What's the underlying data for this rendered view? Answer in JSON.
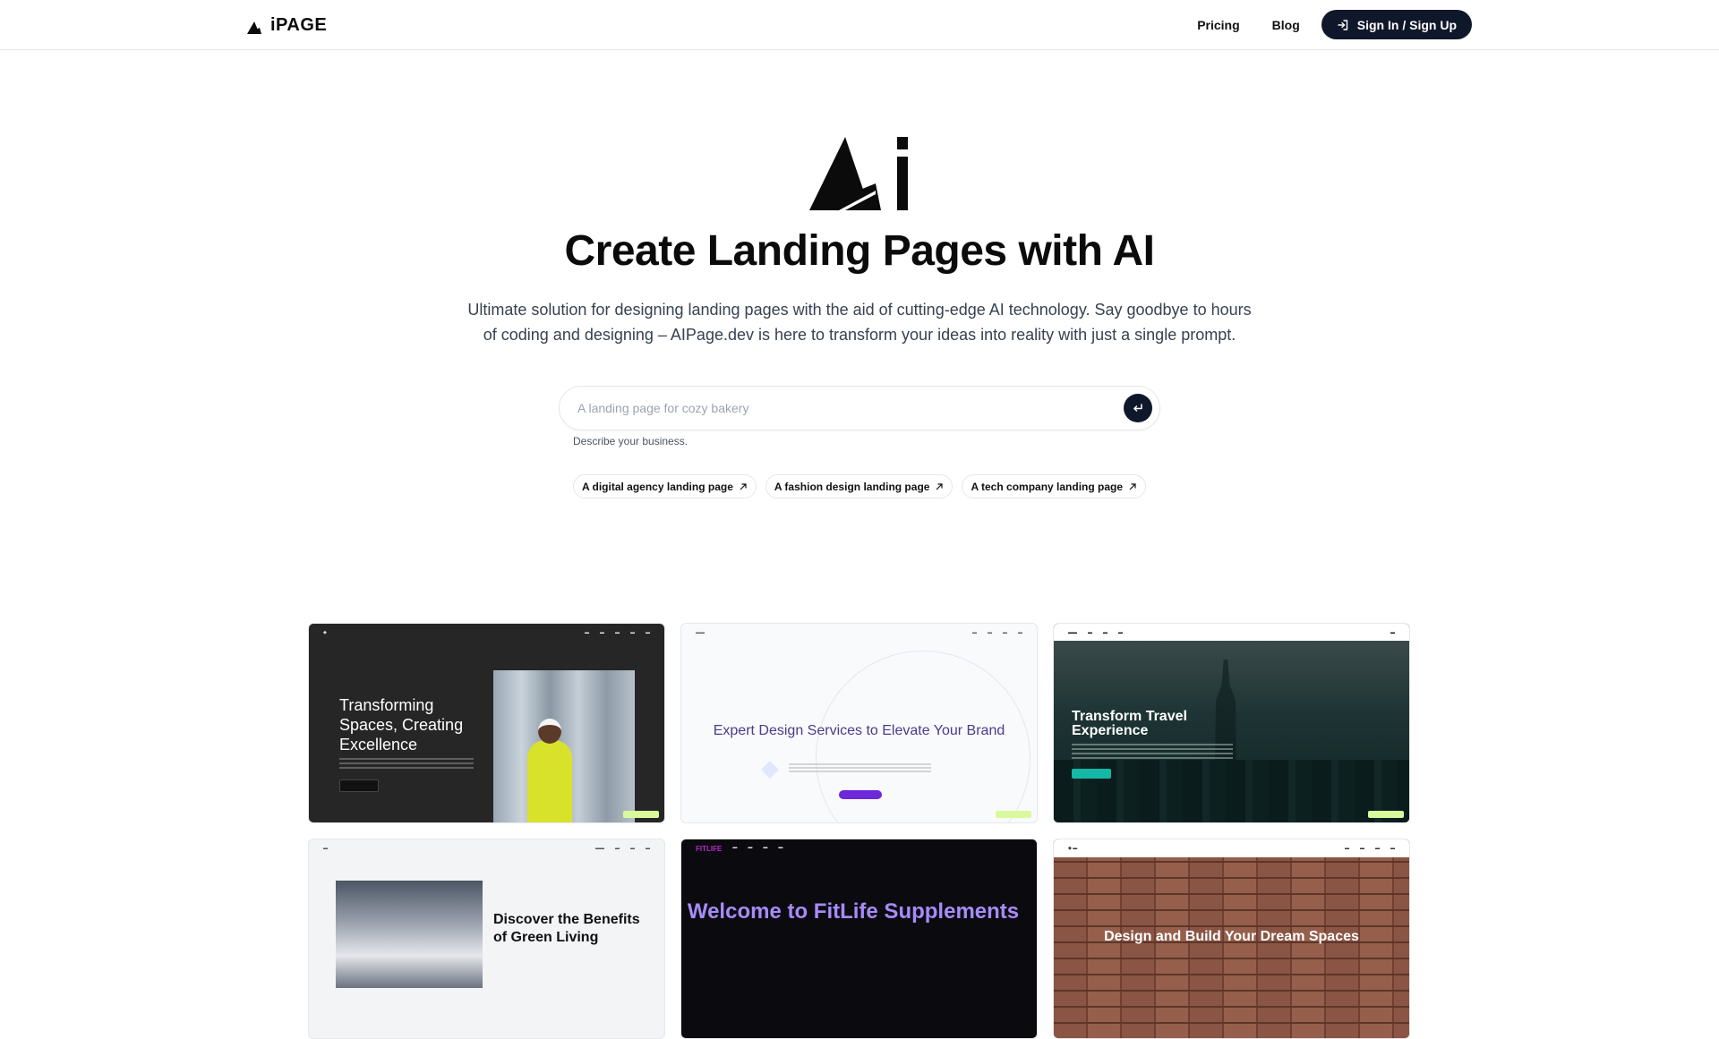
{
  "header": {
    "logo_text": "iPAGE",
    "nav": {
      "pricing": "Pricing",
      "blog": "Blog"
    },
    "signin_label": "Sign In / Sign Up"
  },
  "hero": {
    "title": "Create Landing Pages with AI",
    "subtitle": "Ultimate solution for designing landing pages with the aid of cutting-edge AI technology. Say goodbye to hours of coding and designing – AIPage.dev is here to transform your ideas into reality with just a single prompt.",
    "search_placeholder": "A landing page for cozy bakery",
    "hint": "Describe your business."
  },
  "suggestions": [
    "A digital agency landing page",
    "A fashion design landing page",
    "A tech company landing page"
  ],
  "gallery": [
    {
      "title": "Transforming Spaces, Creating Excellence"
    },
    {
      "title": "Expert Design Services to Elevate Your Brand"
    },
    {
      "title": "Transform Travel Experience"
    },
    {
      "title": "Discover the Benefits of Green Living"
    },
    {
      "title": "Welcome to FitLife Supplements",
      "brand": "FITLIFE"
    },
    {
      "title": "Design and Build Your Dream Spaces"
    }
  ],
  "colors": {
    "primary": "#0f172a",
    "badge": "#d9f99d"
  }
}
